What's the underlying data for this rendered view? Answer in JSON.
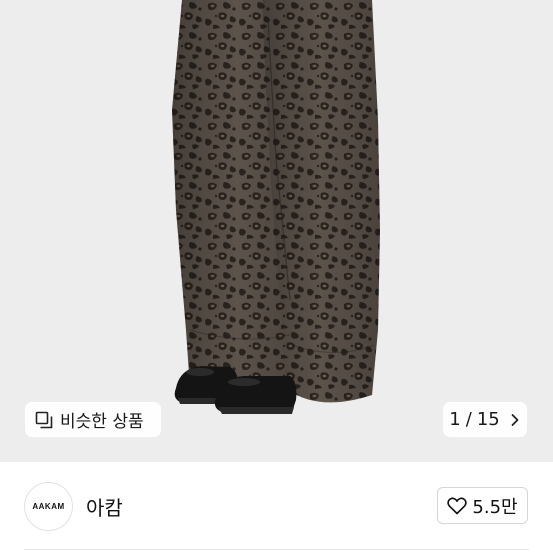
{
  "gallery": {
    "similar_products_label": "비슷한 상품",
    "current_page": "1",
    "page_separator": "/",
    "total_pages": "15"
  },
  "shop": {
    "avatar_text": "AAKAM",
    "name": "아캄",
    "like_count": "5.5만"
  },
  "icons": {
    "similar": "copy-squares-icon",
    "next": "chevron-right-icon",
    "like": "heart-outline-icon"
  },
  "colors": {
    "image_background": "#ededed",
    "pants_base": "#5c534b",
    "spots": "#2a2420",
    "shoes": "#141414"
  }
}
